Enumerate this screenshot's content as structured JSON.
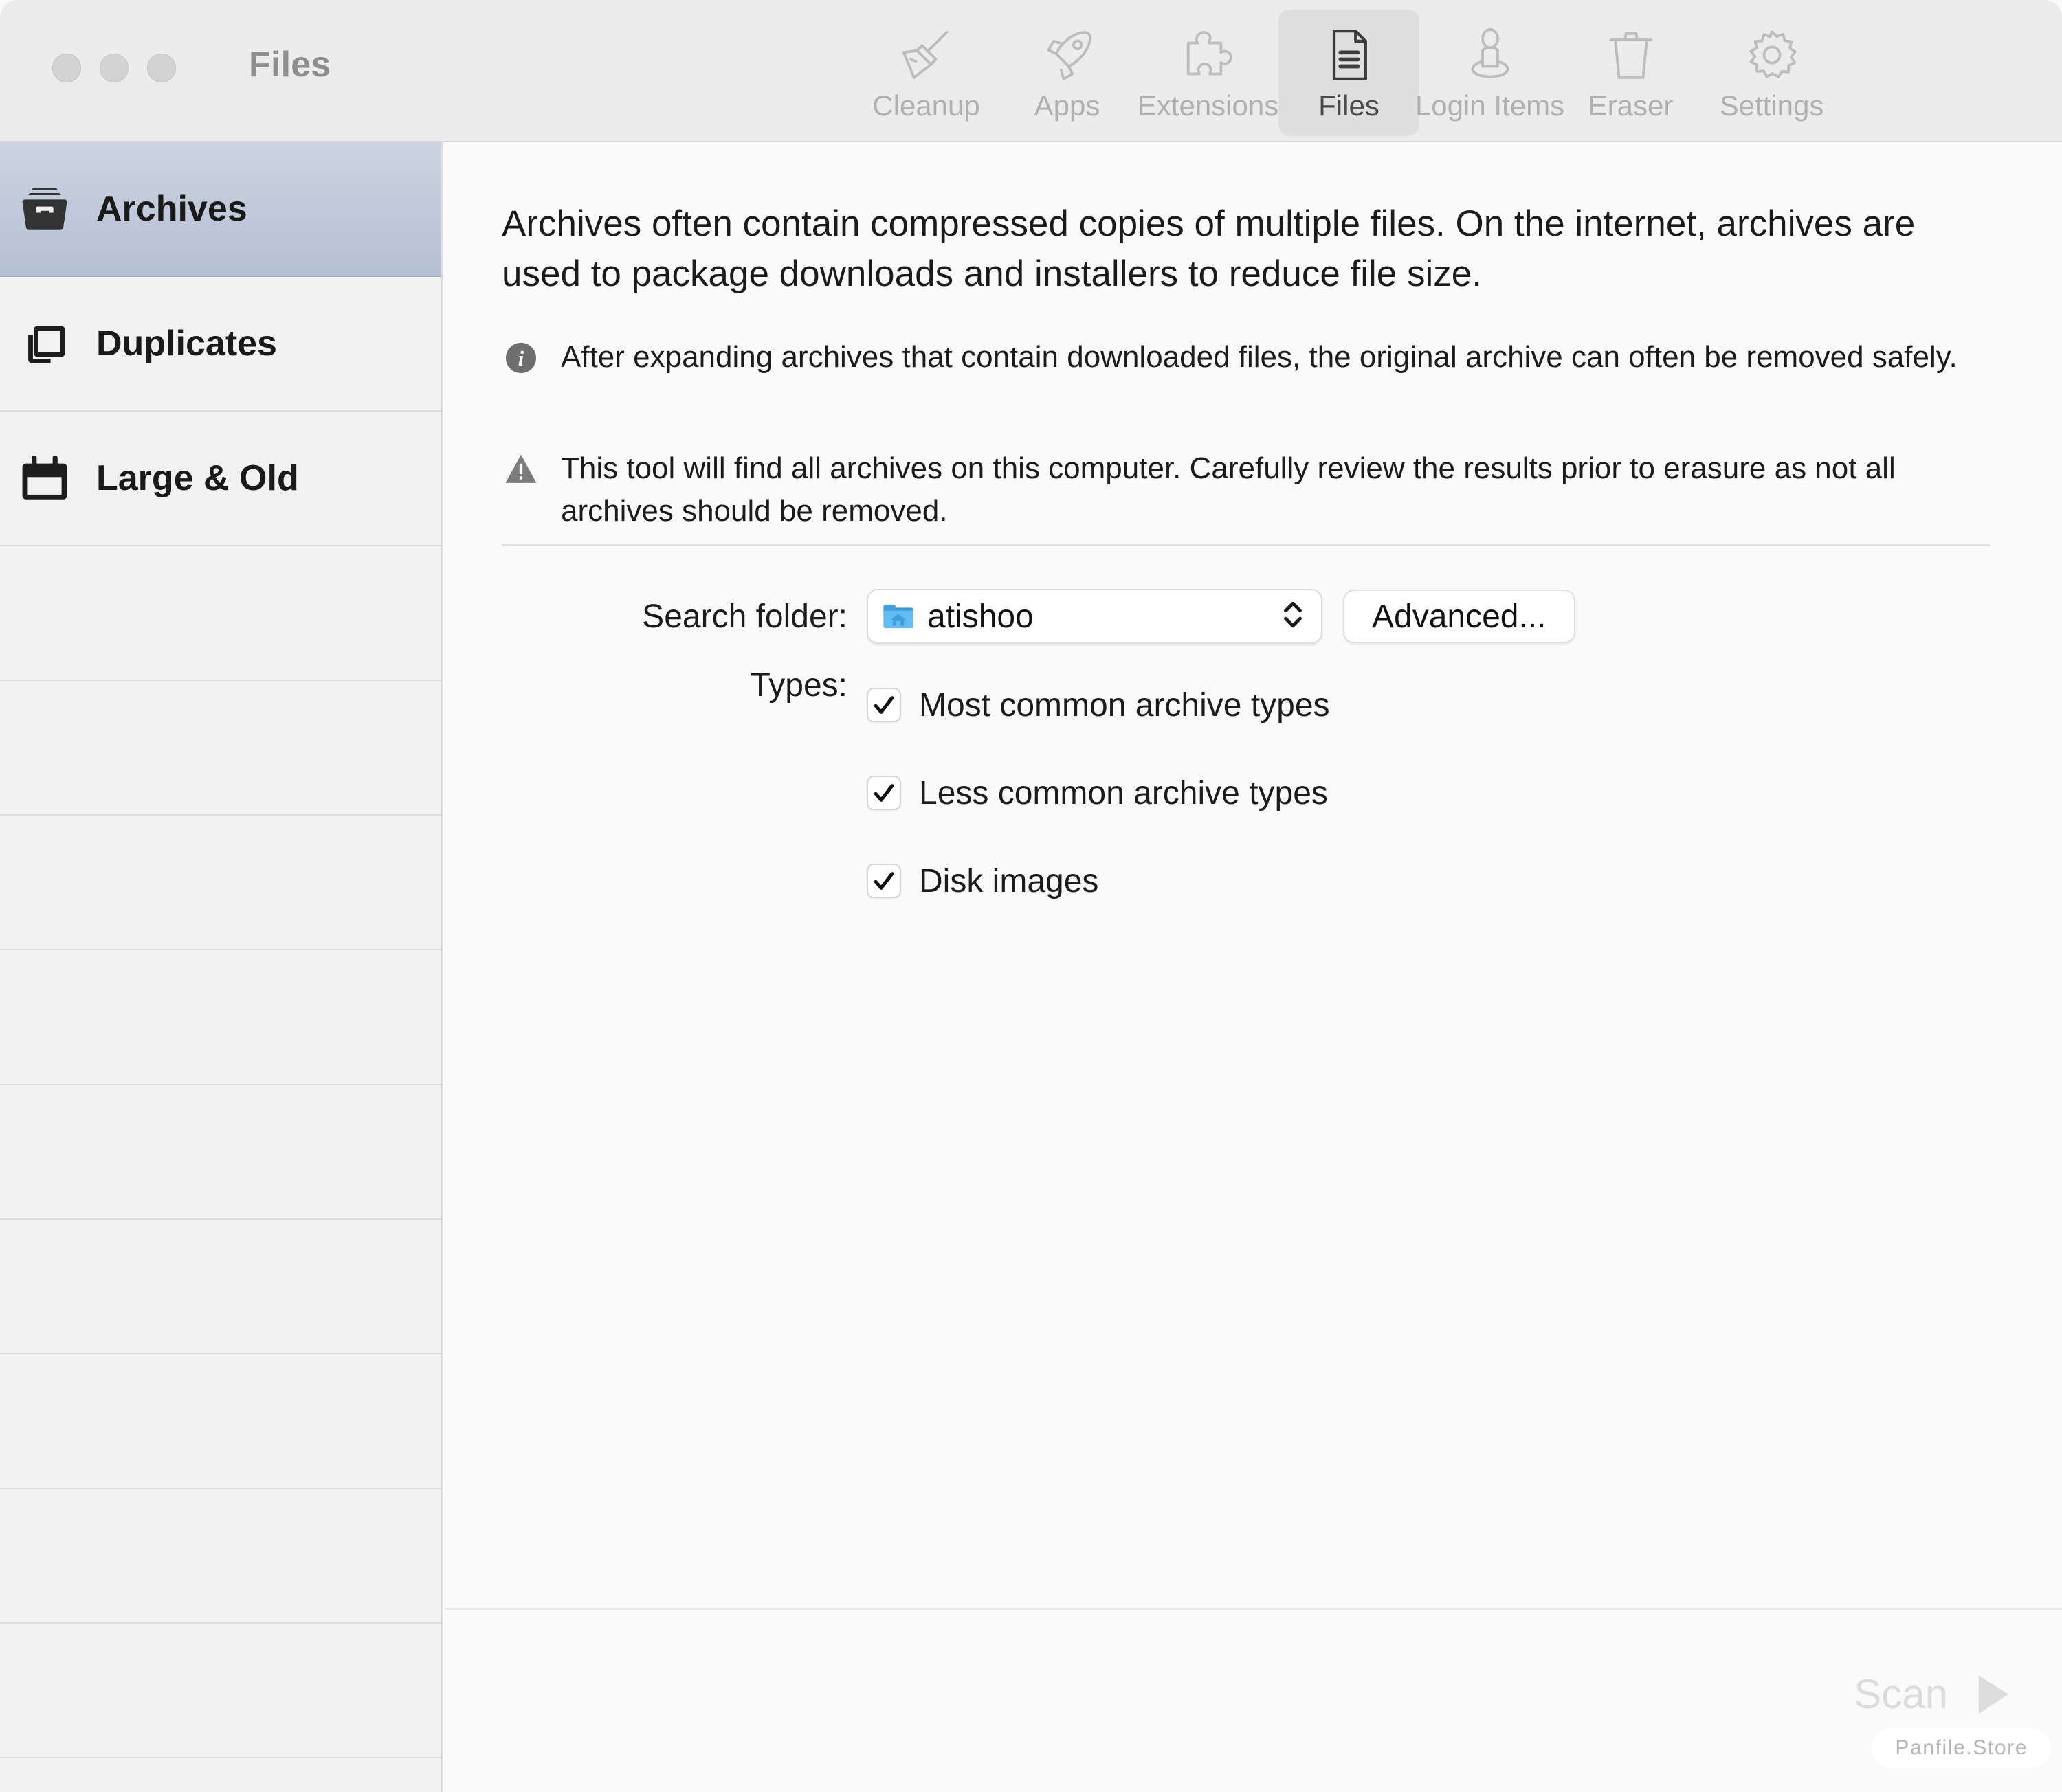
{
  "window": {
    "title": "Files",
    "traffic_lights": [
      "close",
      "minimize",
      "zoom"
    ]
  },
  "toolbar": {
    "items": [
      {
        "label": "Cleanup",
        "icon": "broom-icon",
        "selected": false
      },
      {
        "label": "Apps",
        "icon": "rocket-icon",
        "selected": false
      },
      {
        "label": "Extensions",
        "icon": "puzzle-piece-icon",
        "selected": false
      },
      {
        "label": "Files",
        "icon": "document-icon",
        "selected": true
      },
      {
        "label": "Login Items",
        "icon": "person-icon",
        "selected": false
      },
      {
        "label": "Eraser",
        "icon": "trash-icon",
        "selected": false
      },
      {
        "label": "Settings",
        "icon": "gear-icon",
        "selected": false
      }
    ]
  },
  "sidebar": {
    "items": [
      {
        "label": "Archives",
        "icon": "archive-box-icon",
        "selected": true
      },
      {
        "label": "Duplicates",
        "icon": "duplicate-icon",
        "selected": false
      },
      {
        "label": "Large & Old",
        "icon": "calendar-icon",
        "selected": false
      }
    ],
    "empty_row_count": 9
  },
  "main": {
    "intro": "Archives often contain compressed copies of multiple files. On the internet, archives are used to package downloads and installers to reduce file size.",
    "notes": [
      {
        "icon": "info-icon",
        "text": "After expanding archives that contain downloaded files, the original archive can often be removed safely."
      },
      {
        "icon": "warning-icon",
        "text": "This tool will find all archives on this computer. Carefully review the results prior to erasure as not all archives should be removed."
      }
    ],
    "search_folder": {
      "label": "Search folder:",
      "value": "atishoo",
      "icon": "home-folder-icon"
    },
    "advanced_button": "Advanced...",
    "types": {
      "label": "Types:",
      "options": [
        {
          "label": "Most common archive types",
          "checked": true
        },
        {
          "label": "Less common archive types",
          "checked": true
        },
        {
          "label": "Disk images",
          "checked": true
        }
      ]
    }
  },
  "bottom": {
    "scan_label": "Scan",
    "scan_icon": "play-triangle-icon",
    "scan_enabled": false,
    "watermark": "Panfile.Store"
  },
  "colors": {
    "toolbar_bg": "#ececec",
    "sidebar_bg": "#f1f1f1",
    "content_bg": "#fafafa",
    "selection_top": "#ccd3e1",
    "selection_bottom": "#b6c0d3",
    "folder_blue": "#55b4ef",
    "disabled_text": "#dcdcdc"
  }
}
